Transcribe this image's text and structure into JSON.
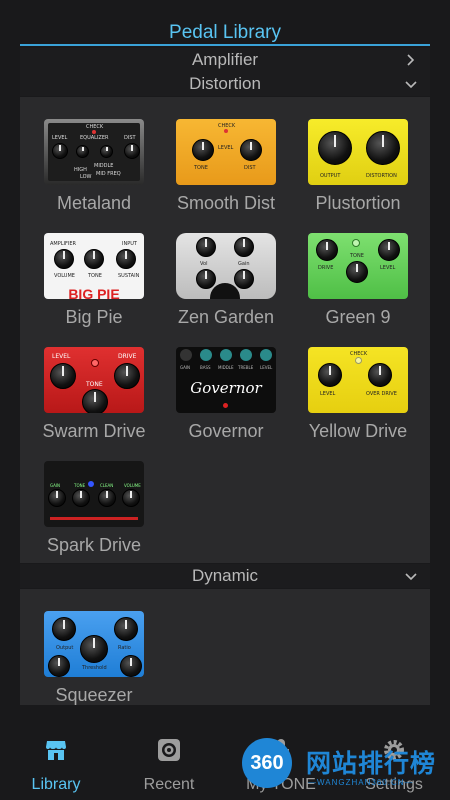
{
  "header": {
    "title": "Pedal Library"
  },
  "categories": [
    {
      "label": "Amplifier",
      "state": "collapsed"
    },
    {
      "label": "Distortion",
      "state": "expanded"
    },
    {
      "label": "Dynamic",
      "state": "expanded"
    }
  ],
  "distortion_pedals": [
    {
      "name": "Metaland"
    },
    {
      "name": "Smooth Dist"
    },
    {
      "name": "Plustortion"
    },
    {
      "name": "Big Pie"
    },
    {
      "name": "Zen Garden"
    },
    {
      "name": "Green 9"
    },
    {
      "name": "Swarm Drive"
    },
    {
      "name": "Governor"
    },
    {
      "name": "Yellow Drive"
    },
    {
      "name": "Spark Drive"
    }
  ],
  "dynamic_pedals": [
    {
      "name": "Squeezer"
    }
  ],
  "pedal_art": {
    "metaland": {
      "check": "CHECK",
      "level": "LEVEL",
      "eq": "EQUALIZER",
      "dist": "DIST",
      "high": "HIGH",
      "middle": "MIDDLE",
      "low": "LOW",
      "mid_freq": "MID FREQ"
    },
    "smooth_dist": {
      "check": "CHECK",
      "level": "LEVEL",
      "tone": "TONE",
      "dist": "DIST"
    },
    "plustortion": {
      "output": "OUTPUT",
      "distortion": "DISTORTION"
    },
    "big_pie": {
      "amplifier": "AMPLIFIER",
      "input": "INPUT",
      "volume": "VOLUME",
      "tone": "TONE",
      "sustain": "SUSTAIN",
      "logo": "BIG PIE"
    },
    "zen_garden": {
      "vol": "Vol",
      "gain": "Gain"
    },
    "green_9": {
      "tone": "TONE",
      "drive": "DRIVE",
      "level": "LEVEL"
    },
    "swarm_drive": {
      "level": "LEVEL",
      "drive": "DRIVE",
      "tone": "TONE"
    },
    "governor": {
      "gain": "GAIN",
      "bass": "BASS",
      "middle": "MIDDLE",
      "treble": "TREBLE",
      "level": "LEVEL",
      "logo": "Governor"
    },
    "yellow_drive": {
      "check": "CHECK",
      "level": "LEVEL",
      "over_drive": "OVER DRIVE"
    },
    "spark_drive": {
      "gain": "GAIN",
      "tone": "TONE",
      "clean": "CLEAN",
      "volume": "VOLUME"
    },
    "squeezer": {
      "output": "Output",
      "ratio": "Ratio",
      "threshold": "Threshold"
    }
  },
  "tabs": [
    {
      "label": "Library",
      "icon": "store-icon",
      "active": true
    },
    {
      "label": "Recent",
      "icon": "record-icon",
      "active": false
    },
    {
      "label": "My TONE",
      "icon": "mic-icon",
      "active": false
    },
    {
      "label": "Settings",
      "icon": "gear-icon",
      "active": false
    }
  ],
  "watermark": {
    "text": "网站排行榜",
    "badge": "360",
    "url": "—WANGZHAN360.CN—"
  },
  "colors": {
    "accent": "#59c4f2",
    "background": "#19191b",
    "panel": "#2a2a2c",
    "label": "#a8a8a8"
  }
}
